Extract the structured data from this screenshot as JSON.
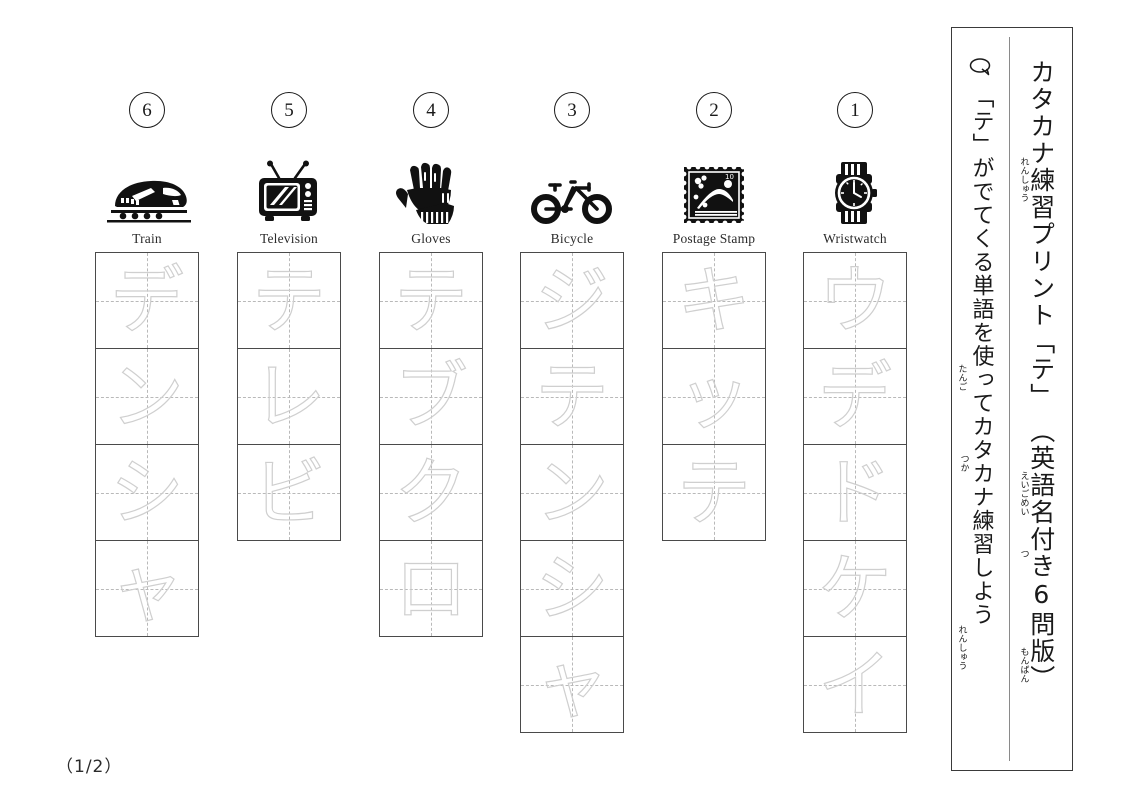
{
  "document": {
    "kind": "katakana-practice-worksheet",
    "page_number": "（1/2）"
  },
  "title_panel": {
    "bubble_icon": "speech-bubble-icon",
    "main_line": "カタカナ練習プリント「テ」",
    "main_paren": "（英語名付き6問版）",
    "sub_line": "「テ」がでてくる単語を使ってカタカナ練習しよう",
    "ruby": {
      "renshuu_1": "れんしゅう",
      "eigomei": "えいごめい",
      "tsuki": "つ",
      "monban": "もんばん",
      "tango": "たんご",
      "tsuka": "つか",
      "renshuu_2": "れんしゅう"
    }
  },
  "problems": [
    {
      "number": "6",
      "icon": "train-icon",
      "word_en": "Train",
      "word_ja": "デンシャ",
      "characters": [
        "デ",
        "ン",
        "シ",
        "ャ"
      ]
    },
    {
      "number": "5",
      "icon": "television-icon",
      "word_en": "Television",
      "word_ja": "テレビ",
      "characters": [
        "テ",
        "レ",
        "ビ"
      ]
    },
    {
      "number": "4",
      "icon": "gloves-icon",
      "word_en": "Gloves",
      "word_ja": "テブクロ",
      "characters": [
        "テ",
        "ブ",
        "ク",
        "ロ"
      ]
    },
    {
      "number": "3",
      "icon": "bicycle-icon",
      "word_en": "Bicycle",
      "word_ja": "ジテンシャ",
      "characters": [
        "ジ",
        "テ",
        "ン",
        "シ",
        "ャ"
      ]
    },
    {
      "number": "2",
      "icon": "postage-stamp-icon",
      "word_en": "Postage Stamp",
      "word_ja": "キッテ",
      "characters": [
        "キ",
        "ッ",
        "テ"
      ]
    },
    {
      "number": "1",
      "icon": "wristwatch-icon",
      "word_en": "Wristwatch",
      "word_ja": "ウデドケイ",
      "characters": [
        "ウ",
        "デ",
        "ド",
        "ケ",
        "イ"
      ]
    }
  ],
  "colors": {
    "ink": "#1a1a1a",
    "box_border": "#4a4a4a",
    "guide_line": "#b9b9b9",
    "trace_char": "#d4d4d4"
  }
}
